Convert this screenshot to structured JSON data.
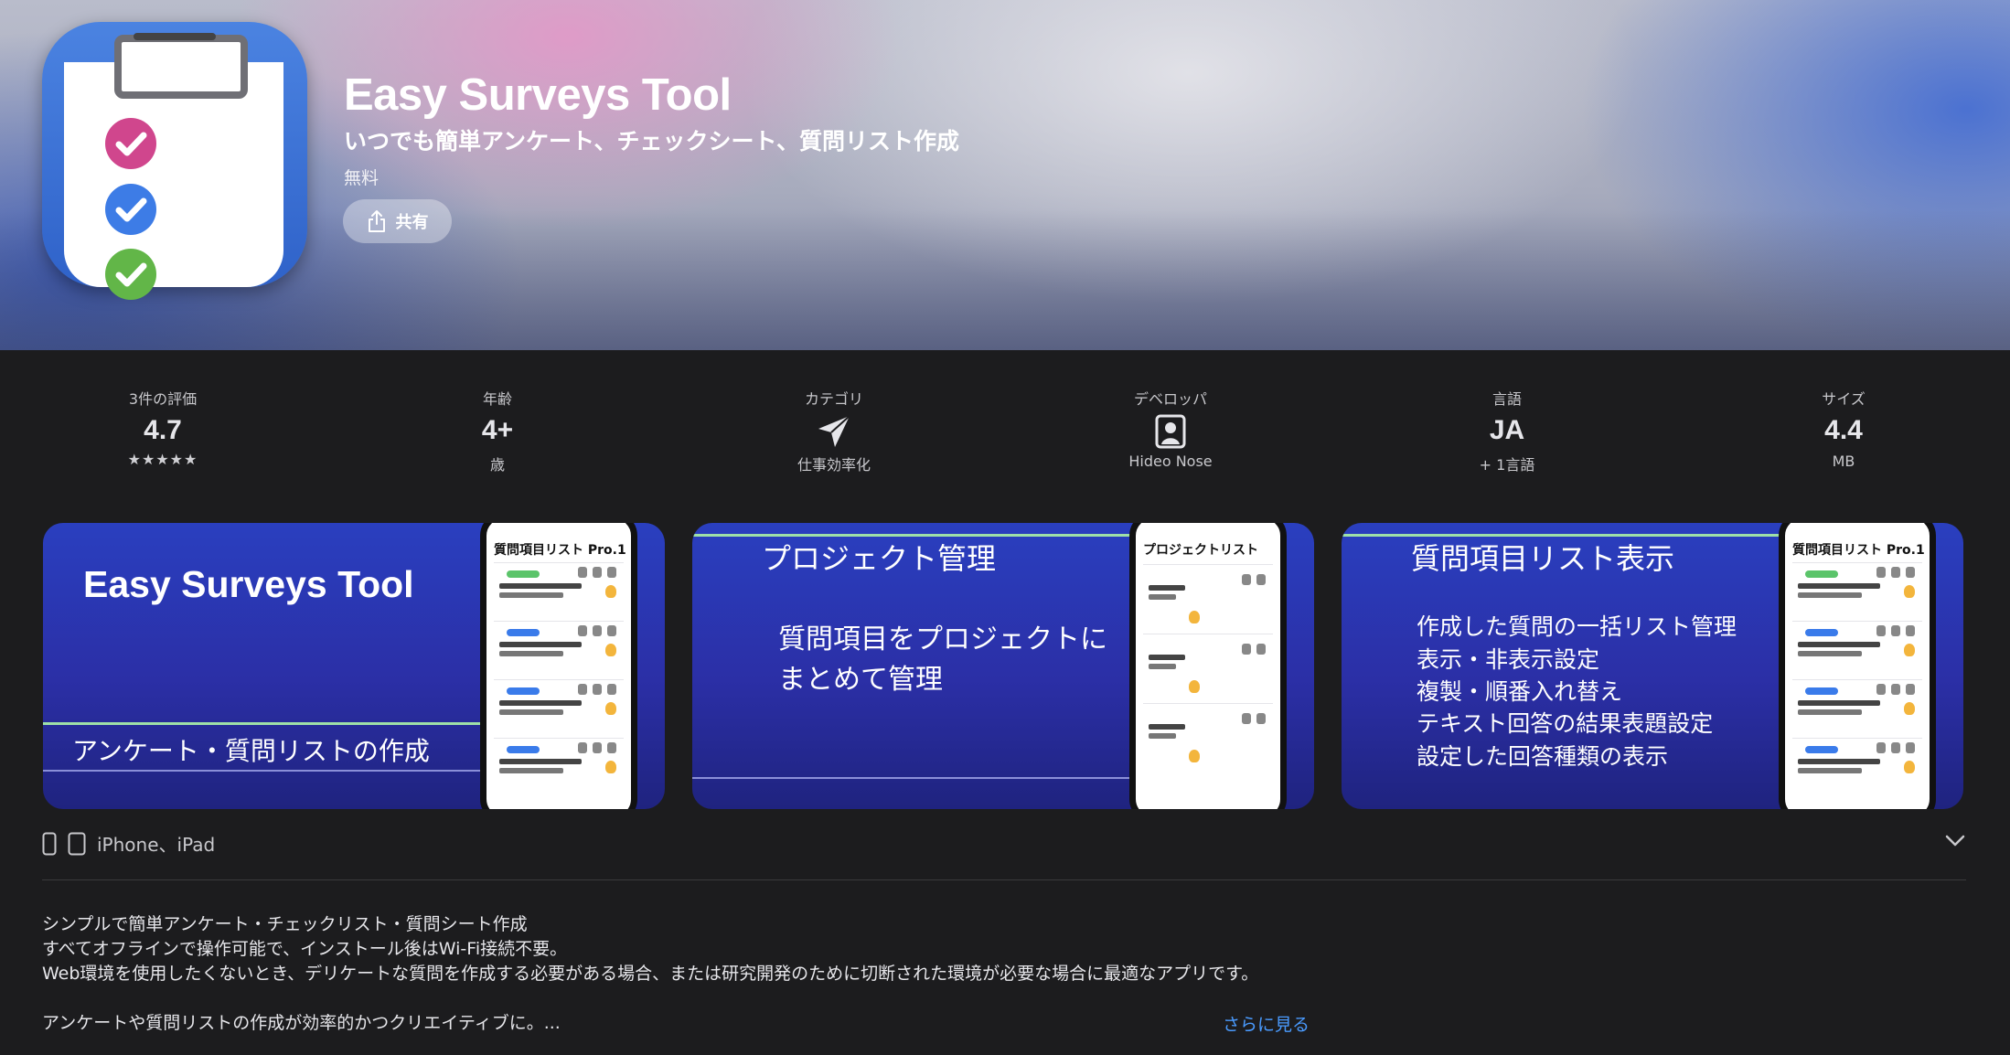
{
  "app": {
    "title": "Easy Surveys Tool",
    "subtitle": "いつでも簡単アンケート、チェックシート、質問リスト作成",
    "price": "無料",
    "share_label": "共有"
  },
  "info": [
    {
      "label": "3件の評価",
      "value": "4.7",
      "sub": "★★★★★"
    },
    {
      "label": "年齢",
      "value": "4+",
      "sub": "歳"
    },
    {
      "label": "カテゴリ",
      "icon": "paper-plane-icon",
      "sub": "仕事効率化"
    },
    {
      "label": "デベロッパ",
      "icon": "person-badge-icon",
      "sub": "Hideo Nose"
    },
    {
      "label": "言語",
      "value": "JA",
      "sub": "+ 1言語"
    },
    {
      "label": "サイズ",
      "value": "4.4",
      "sub": "MB"
    }
  ],
  "screenshots": [
    {
      "heading": "Easy Surveys Tool",
      "caption": "アンケート・質問リストの作成",
      "phone_title": "質問項目リスト Pro.1"
    },
    {
      "heading": "プロジェクト管理",
      "body": [
        "質問項目をプロジェクトに",
        "まとめて管理"
      ],
      "phone_title": "プロジェクトリスト"
    },
    {
      "heading": "質問項目リスト表示",
      "body": [
        "作成した質問の一括リスト管理",
        "表示・非表示設定",
        "複製・順番入れ替え",
        "テキスト回答の結果表題設定",
        "設定した回答種類の表示"
      ],
      "phone_title": "質問項目リスト Pro.1"
    }
  ],
  "devices": {
    "label": "iPhone、iPad"
  },
  "description": {
    "lines": [
      "シンプルで簡単アンケート・チェックリスト・質問シート作成",
      "すべてオフラインで操作可能で、インストール後はWi-Fi接続不要。",
      "Web環境を使用したくないとき、デリケートな質問を作成する必要がある場合、または研究開発のために切断された環境が必要な場合に最適なアプリです。",
      "",
      "アンケートや質問リストの作成が効率的かつクリエイティブに。..."
    ],
    "more_label": "さらに見る"
  },
  "colors": {
    "accent": "#4a9bff",
    "background": "#1c1c1e"
  }
}
